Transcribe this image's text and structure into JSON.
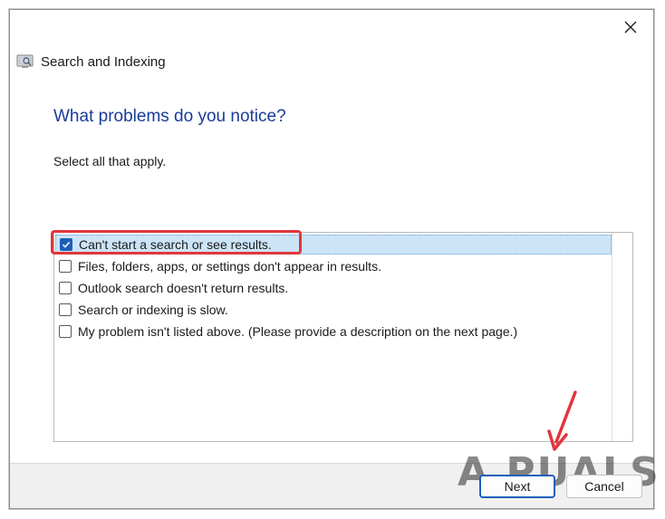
{
  "window": {
    "title": "Search and Indexing",
    "close_icon": "close-icon",
    "app_icon": "search-indexing-icon"
  },
  "main": {
    "heading": "What problems do you notice?",
    "instruction": "Select all that apply."
  },
  "options": [
    {
      "label": "Can't start a search or see results.",
      "checked": true
    },
    {
      "label": "Files, folders, apps, or settings don't appear in results.",
      "checked": false
    },
    {
      "label": "Outlook search doesn't return results.",
      "checked": false
    },
    {
      "label": "Search or indexing is slow.",
      "checked": false
    },
    {
      "label": "My problem isn't listed above. (Please provide a description on the next page.)",
      "checked": false
    }
  ],
  "footer": {
    "next_label": "Next",
    "cancel_label": "Cancel"
  },
  "watermark": {
    "text": "A  PUALS"
  },
  "colors": {
    "heading": "#1a3b9a",
    "highlight": "#e0363c",
    "selection": "#cce4f7",
    "accent": "#1d5fb8"
  }
}
